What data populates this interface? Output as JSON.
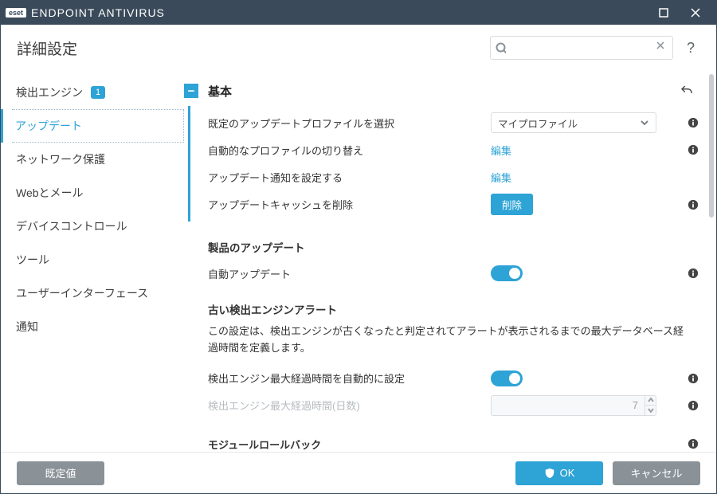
{
  "titlebar": {
    "brand_badge": "eset",
    "brand_name": "ENDPOINT ANTIVIRUS"
  },
  "header": {
    "page_title": "詳細設定",
    "search_placeholder": "",
    "help_label": "?"
  },
  "sidebar": {
    "items": [
      {
        "label": "検出エンジン",
        "badge": "1"
      },
      {
        "label": "アップデート"
      },
      {
        "label": "ネットワーク保護"
      },
      {
        "label": "Webとメール"
      },
      {
        "label": "デバイスコントロール"
      },
      {
        "label": "ツール"
      },
      {
        "label": "ユーザーインターフェース"
      },
      {
        "label": "通知"
      }
    ]
  },
  "section": {
    "title": "基本",
    "rows": {
      "default_profile_label": "既定のアップデートプロファイルを選択",
      "default_profile_value": "マイプロファイル",
      "auto_switch_label": "自動的なプロファイルの切り替え",
      "auto_switch_action": "編集",
      "notify_label": "アップデート通知を設定する",
      "notify_action": "編集",
      "clear_cache_label": "アップデートキャッシュを削除",
      "clear_cache_action": "削除"
    },
    "product_updates_heading": "製品のアップデート",
    "auto_update_label": "自動アップデート",
    "old_engine_heading": "古い検出エンジンアラート",
    "old_engine_desc": "この設定は、検出エンジンが古くなったと判定されてアラートが表示されるまでの最大データベース経過時間を定義します。",
    "auto_age_label": "検出エンジン最大経過時間を自動的に設定",
    "age_days_label": "検出エンジン最大経過時間(日数)",
    "age_days_value": "7",
    "rollback_heading": "モジュールロールバック"
  },
  "footer": {
    "defaults_label": "既定値",
    "ok_label": "OK",
    "cancel_label": "キャンセル"
  }
}
